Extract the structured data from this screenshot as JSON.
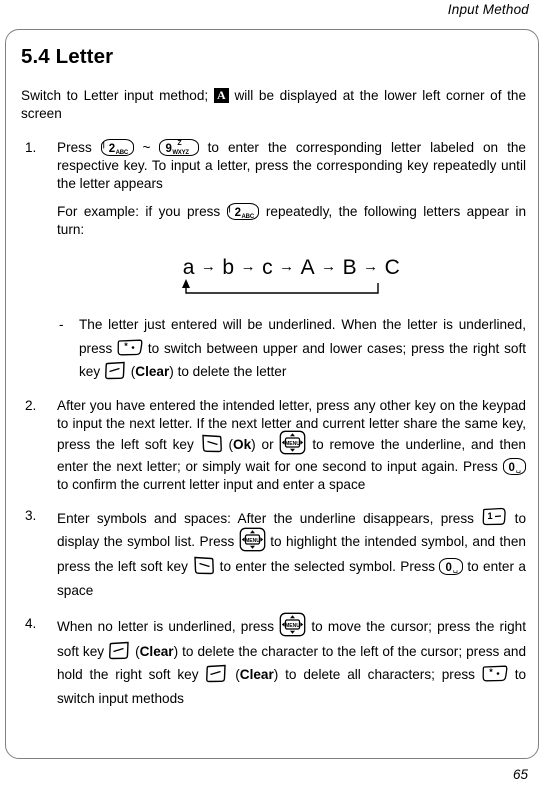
{
  "header": {
    "running_head": "Input Method"
  },
  "page": {
    "folio": "65"
  },
  "section": {
    "title": "5.4 Letter",
    "intro_before_icon": "Switch to Letter input method;",
    "intro_icon_label": "A",
    "intro_after_icon": "will be displayed at the lower left corner of the screen"
  },
  "keys": {
    "k2": {
      "digit": "2",
      "letters": "ABC",
      "tick": "|"
    },
    "k9": {
      "digit": "9",
      "letters": "WXYZ",
      "tick": "Z"
    },
    "k0": {
      "digit": "0",
      "mark": "␣"
    },
    "k1": {
      "digit": "1",
      "mark": "–"
    },
    "kstar": {
      "digit": "*",
      "mark": "•"
    },
    "nav_label": "MENU",
    "softkey_left_name": "left soft key",
    "softkey_right_name": "right soft key"
  },
  "steps": [
    {
      "num": "1.",
      "p1_a": "Press",
      "p1_b": "~",
      "p1_c": "to enter the corresponding letter labeled on the respective key. To input a letter, press the corresponding key repeatedly until the letter appears",
      "p2_a": "For example: if you press",
      "p2_b": "repeatedly, the following letters appear in turn:",
      "sequence": {
        "items": [
          "a",
          "b",
          "c",
          "A",
          "B",
          "C"
        ],
        "arrow": "→",
        "loop": "from C back to a"
      },
      "sub": {
        "dash": "-",
        "t1": "The letter just entered will be underlined. When the letter is underlined, press",
        "t2": "to switch between upper and lower cases; press the right soft key",
        "t3": "(",
        "t4": "Clear",
        "t5": ") to delete the letter"
      }
    },
    {
      "num": "2.",
      "t1": "After you have entered the intended letter, press any other key on the keypad to input the next letter. If the next letter and current letter share the same key, press the left soft key",
      "t2": "(",
      "t3": "Ok",
      "t4": ") or",
      "t5": "to remove the underline, and then enter the next letter; or simply wait for one second to input again. Press",
      "t6": "to confirm the current letter input and enter a space"
    },
    {
      "num": "3.",
      "t1": "Enter symbols and spaces: After the underline disappears, press",
      "t2": "to display the symbol list. Press",
      "t3": "to highlight the intended symbol, and then press the left soft key",
      "t4": "to enter the selected symbol. Press",
      "t5": "to enter a space"
    },
    {
      "num": "4.",
      "t1": "When no letter is underlined, press",
      "t2": "to move the cursor; press the right soft key",
      "t3": "(",
      "t4": "Clear",
      "t5": ") to delete the character to the left of the cursor; press and hold the right soft key",
      "t6": "(",
      "t7": "Clear",
      "t8": ") to delete all characters; press",
      "t9": "to switch input methods"
    }
  ]
}
